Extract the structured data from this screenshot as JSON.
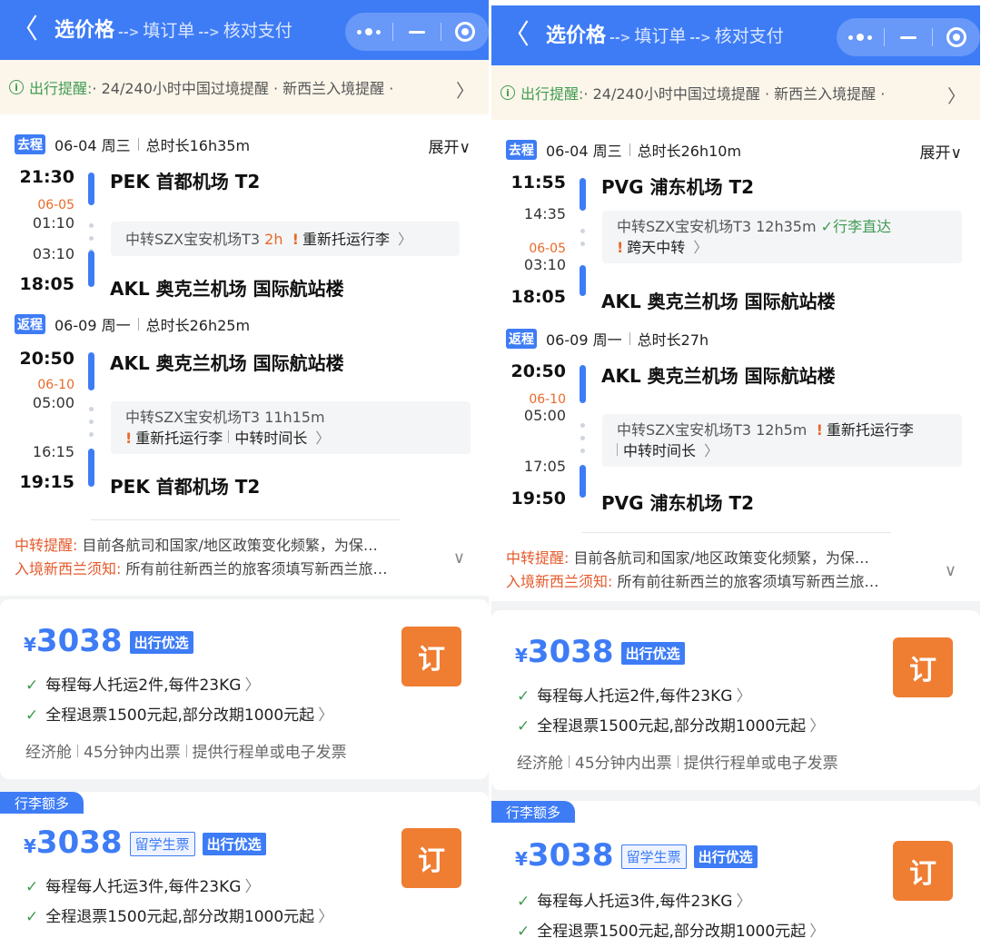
{
  "header": {
    "back": "〈",
    "title": "选价格",
    "step2": "填订单",
    "step3": "核对支付",
    "arrow": "-->"
  },
  "notice": {
    "icon": "i",
    "label": "出行提醒:",
    "text": "· 24/240小时中国过境提醒 · 新西兰入境提醒 ·",
    "chevron": "〉"
  },
  "common": {
    "expand": "展开∨",
    "outbound_tag": "去程",
    "return_tag": "返程",
    "book": "订",
    "check": "✓",
    "chev": "〉",
    "warn": "!",
    "tip1_key": "中转提醒:",
    "tip1_val": "目前各航司和国家/地区政策变化频繁，为保…",
    "tip2_key": "入境新西兰须知:",
    "tip2_val": "所有前往新西兰的旅客须填写新西兰旅…",
    "tip_chev": "∨",
    "price_cur": "¥",
    "badge_pref": "出行优选",
    "badge_student": "留学生票",
    "ribbon": "行李额多",
    "card1_line1": "每程每人托运2件,每件23KG",
    "card2_line1": "每程每人托运3件,每件23KG",
    "line2": "全程退票1500元起,部分改期1000元起",
    "meta1": "经济舱",
    "meta2": "45分钟内出票",
    "meta3": "提供行程单或电子发票"
  },
  "left": {
    "out": {
      "date": "06-04 周三",
      "duration": "总时长16h35m",
      "dep_time": "21:30",
      "dep_ap": "PEK 首都机场 T2",
      "next_day": "06-05",
      "arr1": "01:10",
      "dep2": "03:10",
      "arr_time": "18:05",
      "arr_ap": "AKL 奥克兰机场 国际航站楼",
      "transfer": "中转SZX宝安机场T3",
      "transfer_dur": "2h",
      "transfer_note": "重新托运行李"
    },
    "ret": {
      "date": "06-09 周一",
      "duration": "总时长26h25m",
      "dep_time": "20:50",
      "dep_ap": "AKL 奥克兰机场 国际航站楼",
      "next_day": "06-10",
      "arr1": "05:00",
      "dep2": "16:15",
      "arr_time": "19:15",
      "arr_ap": "PEK 首都机场 T2",
      "transfer": "中转SZX宝安机场T3 11h15m",
      "transfer_note": "重新托运行李",
      "transfer_note2": "中转时间长"
    },
    "card1_price": "3038",
    "card2_price": "3038"
  },
  "right": {
    "out": {
      "date": "06-04 周三",
      "duration": "总时长26h10m",
      "dep_time": "11:55",
      "dep_ap": "PVG 浦东机场 T2",
      "arr1": "14:35",
      "next_day": "06-05",
      "dep2": "03:10",
      "arr_time": "18:05",
      "arr_ap": "AKL 奥克兰机场 国际航站楼",
      "transfer": "中转SZX宝安机场T3 12h35m",
      "transfer_ok": "✓行李直达",
      "transfer_note": "跨天中转"
    },
    "ret": {
      "date": "06-09 周一",
      "duration": "总时长27h",
      "dep_time": "20:50",
      "dep_ap": "AKL 奥克兰机场 国际航站楼",
      "next_day": "06-10",
      "arr1": "05:00",
      "dep2": "17:05",
      "arr_time": "19:50",
      "arr_ap": "PVG 浦东机场 T2",
      "transfer": "中转SZX宝安机场T3 12h5m",
      "transfer_note": "重新托运行李",
      "transfer_note2": "中转时间长"
    },
    "card1_price": "3038",
    "card2_price": "3038"
  },
  "colors": {
    "primary": "#3e7cf6",
    "orange": "#ef7d32",
    "green": "#3f9b52"
  }
}
